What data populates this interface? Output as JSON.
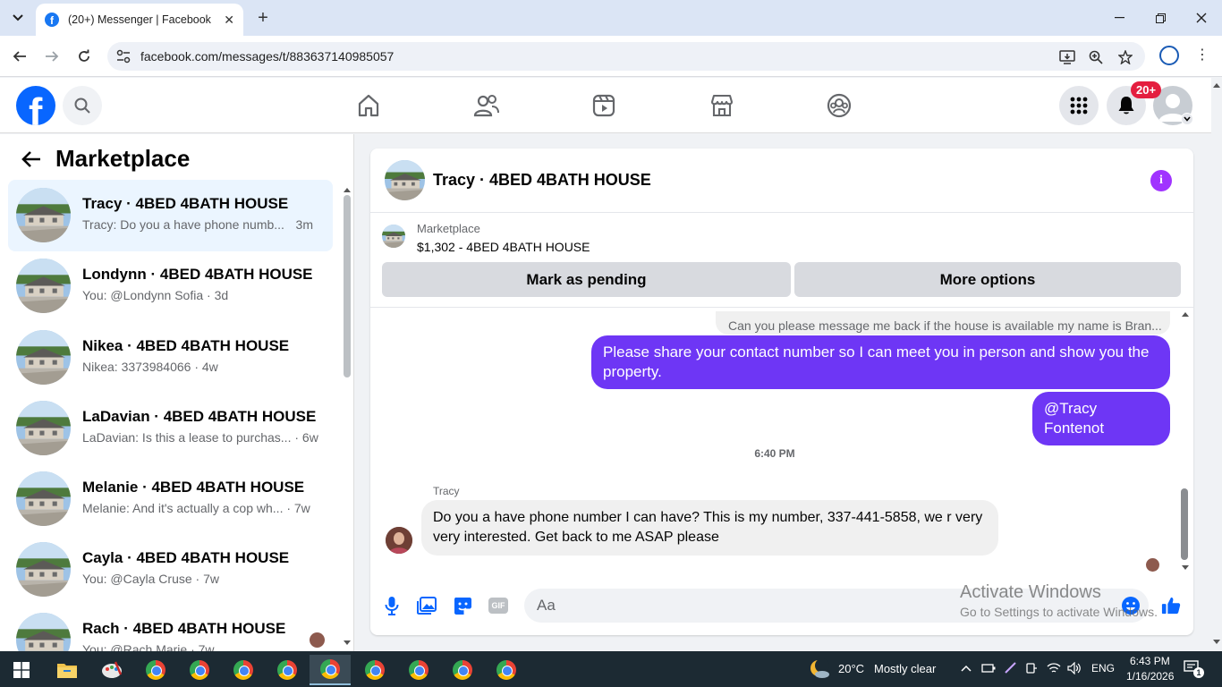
{
  "browser": {
    "tab_title": "(20+) Messenger | Facebook",
    "url": "facebook.com/messages/t/883637140985057",
    "new_tab": "+",
    "close_tab": "✕"
  },
  "fb": {
    "logo_letter": "f",
    "notifications_badge": "20+"
  },
  "sidebar": {
    "title": "Marketplace",
    "conversations": [
      {
        "name": "Tracy · 4BED 4BATH HOUSE",
        "snippet": "Tracy: Do you a have phone numb...",
        "time": "3m",
        "active": true
      },
      {
        "name": "Londynn · 4BED 4BATH HOUSE",
        "snippet": "You: @Londynn Sofia · 3d",
        "time": ""
      },
      {
        "name": "Nikea · 4BED 4BATH HOUSE",
        "snippet": "Nikea: 3373984066 · 4w",
        "time": ""
      },
      {
        "name": "LaDavian · 4BED 4BATH HOUSE",
        "snippet": "LaDavian: Is this a lease to purchas... · 6w",
        "time": ""
      },
      {
        "name": "Melanie · 4BED 4BATH HOUSE",
        "snippet": "Melanie: And it's actually a cop wh... · 7w",
        "time": ""
      },
      {
        "name": "Cayla · 4BED 4BATH HOUSE",
        "snippet": "You: @Cayla Cruse · 7w",
        "time": ""
      },
      {
        "name": "Rach · 4BED 4BATH HOUSE",
        "snippet": "You: @Rach Marie · 7w",
        "time": ""
      }
    ]
  },
  "chat": {
    "title": "Tracy · 4BED 4BATH HOUSE",
    "marketplace_label": "Marketplace",
    "listing": "$1,302 - 4BED 4BATH HOUSE",
    "mark_pending": "Mark as pending",
    "more_options": "More options",
    "prev_message": "Can you please message me back if the house is available my name is Bran...",
    "out_message_1": "Please share your contact number so I can meet you in person and show you the property.",
    "out_message_2": "@Tracy Fontenot",
    "timestamp": "6:40 PM",
    "sender": "Tracy",
    "in_message": "Do you a have phone number I can have? This is my number, 337-441-5858, we r very very interested. Get back to me ASAP please",
    "input_placeholder": "Aa",
    "gif_label": "GIF"
  },
  "watermark": {
    "line1": "Activate Windows",
    "line2": "Go to Settings to activate Windows."
  },
  "taskbar": {
    "weather_temp": "20°C",
    "weather_desc": "Mostly clear",
    "lang": "ENG",
    "time": "6:43 PM",
    "date": "1/16/2026",
    "notif_count": "1"
  },
  "colors": {
    "fb_blue": "#0866ff",
    "outgoing_bubble": "#6e36f5",
    "badge_red": "#e41e3f",
    "info_purple": "#a033ff"
  }
}
